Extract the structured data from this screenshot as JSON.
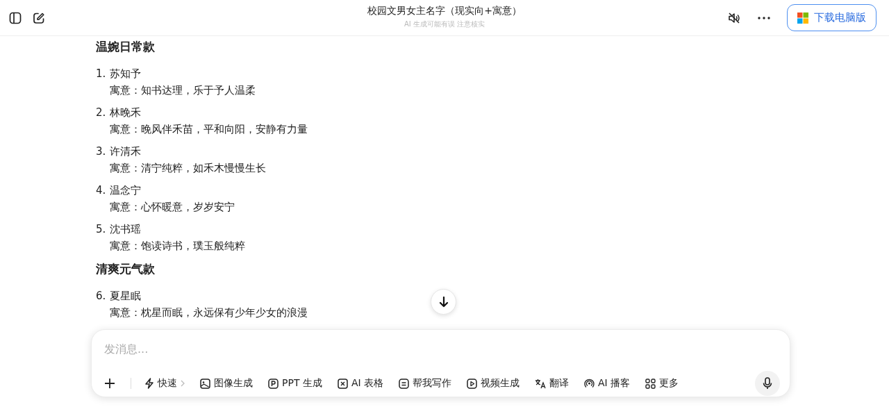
{
  "header": {
    "title": "校园文男女主名字（现实向+寓意）",
    "subtitle": "AI 生成可能有误 注意核实",
    "download_button": "下载电脑版"
  },
  "sections": [
    {
      "heading": "温婉日常款",
      "items": [
        {
          "number": "1.",
          "name": "苏知予",
          "meaning": "寓意：知书达理，乐于予人温柔"
        },
        {
          "number": "2.",
          "name": "林晚禾",
          "meaning": "寓意：晚风伴禾苗，平和向阳，安静有力量"
        },
        {
          "number": "3.",
          "name": "许清禾",
          "meaning": "寓意：清宁纯粹，如禾木慢慢生长"
        },
        {
          "number": "4.",
          "name": "温念宁",
          "meaning": "寓意：心怀暖意，岁岁安宁"
        },
        {
          "number": "5.",
          "name": "沈书瑶",
          "meaning": "寓意：饱读诗书，璞玉般纯粹"
        }
      ]
    },
    {
      "heading": "清爽元气款",
      "items": [
        {
          "number": "6.",
          "name": "夏星眠",
          "meaning": "寓意：枕星而眠，永远保有少年少女的浪漫"
        }
      ]
    }
  ],
  "composer": {
    "placeholder": "发消息...",
    "tools": [
      {
        "kind": "speed",
        "label": "快速"
      },
      {
        "kind": "image",
        "label": "图像生成"
      },
      {
        "kind": "ppt",
        "label": "PPT 生成"
      },
      {
        "kind": "sheet",
        "label": "AI 表格"
      },
      {
        "kind": "write",
        "label": "帮我写作"
      },
      {
        "kind": "video",
        "label": "视频生成"
      },
      {
        "kind": "translate",
        "label": "翻译"
      },
      {
        "kind": "podcast",
        "label": "AI 播客"
      },
      {
        "kind": "more",
        "label": "更多"
      }
    ]
  }
}
